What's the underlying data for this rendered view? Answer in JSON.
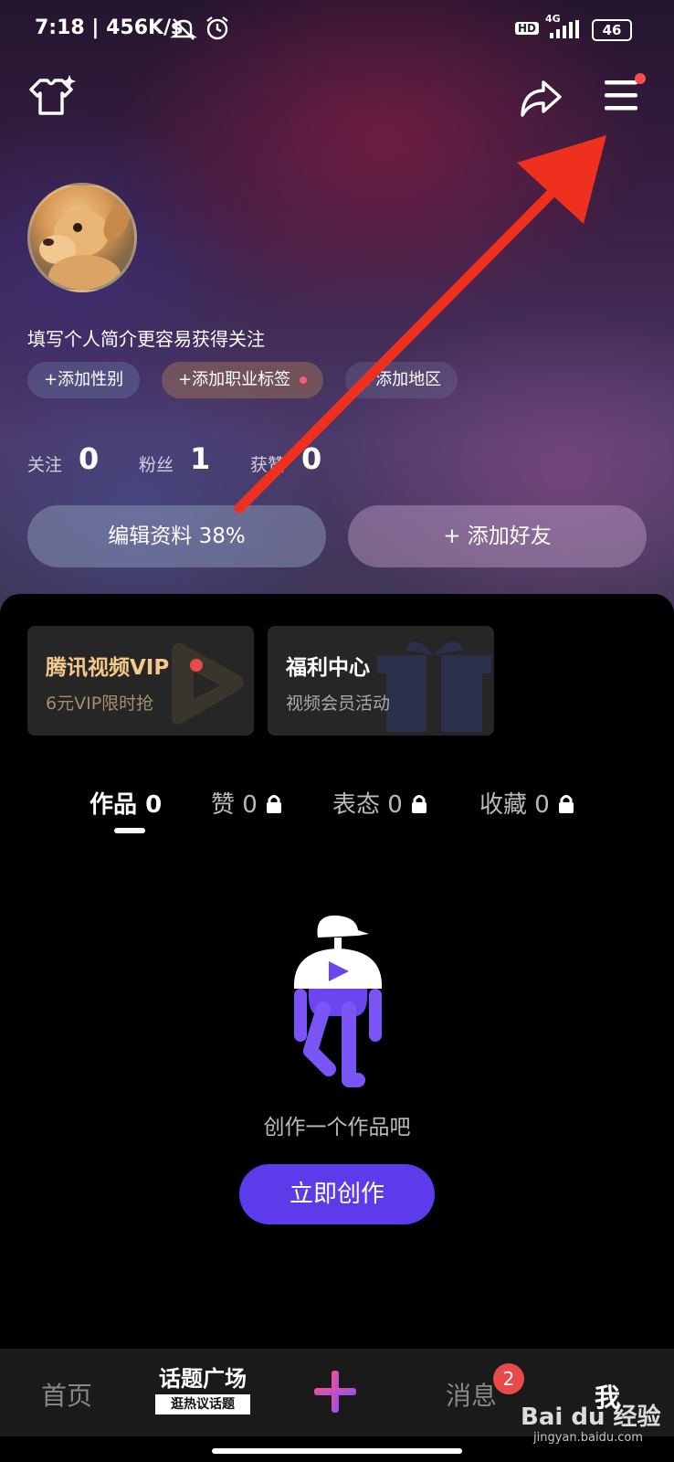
{
  "status_bar": {
    "time": "7:18",
    "speed": "456K/s",
    "hd": "HD",
    "network": "4G",
    "battery": "46"
  },
  "header": {
    "outfit_icon": "tshirt-sparkle-icon",
    "share_icon": "share-arrow-icon",
    "menu_icon": "hamburger-menu-icon",
    "menu_badge_color": "#ff4d4d"
  },
  "profile": {
    "bio_hint": "填写个人简介更容易获得关注",
    "tags": [
      "+添加性别",
      "+添加职业标签",
      "+添加地区"
    ],
    "stats": [
      {
        "label": "关注",
        "value": "0"
      },
      {
        "label": "粉丝",
        "value": "1"
      },
      {
        "label": "获赞",
        "value": "0"
      }
    ],
    "edit_button": "编辑资料 38%",
    "add_friend_button": "+ 添加好友"
  },
  "cards": [
    {
      "title": "腾讯视频VIP",
      "subtitle": "6元VIP限时抢"
    },
    {
      "title": "福利中心",
      "subtitle": "视频会员活动"
    }
  ],
  "tabs": [
    {
      "label": "作品",
      "count": "0",
      "locked": false,
      "active": true
    },
    {
      "label": "赞",
      "count": "0",
      "locked": true
    },
    {
      "label": "表态",
      "count": "0",
      "locked": true
    },
    {
      "label": "收藏",
      "count": "0",
      "locked": true
    }
  ],
  "empty_state": {
    "text": "创作一个作品吧",
    "button": "立即创作"
  },
  "bottom_nav": {
    "home": "首页",
    "topic_title": "话题广场",
    "topic_sub": "逛热议话题",
    "messages": "消息",
    "messages_badge": "2",
    "me": "我"
  },
  "watermark": {
    "brand": "Bai du 经验",
    "url": "jingyan.baidu.com"
  },
  "colors": {
    "accent": "#5b3bea",
    "gold": "#f5c98a",
    "arrow": "#f0301e",
    "badge": "#e84a4a"
  }
}
